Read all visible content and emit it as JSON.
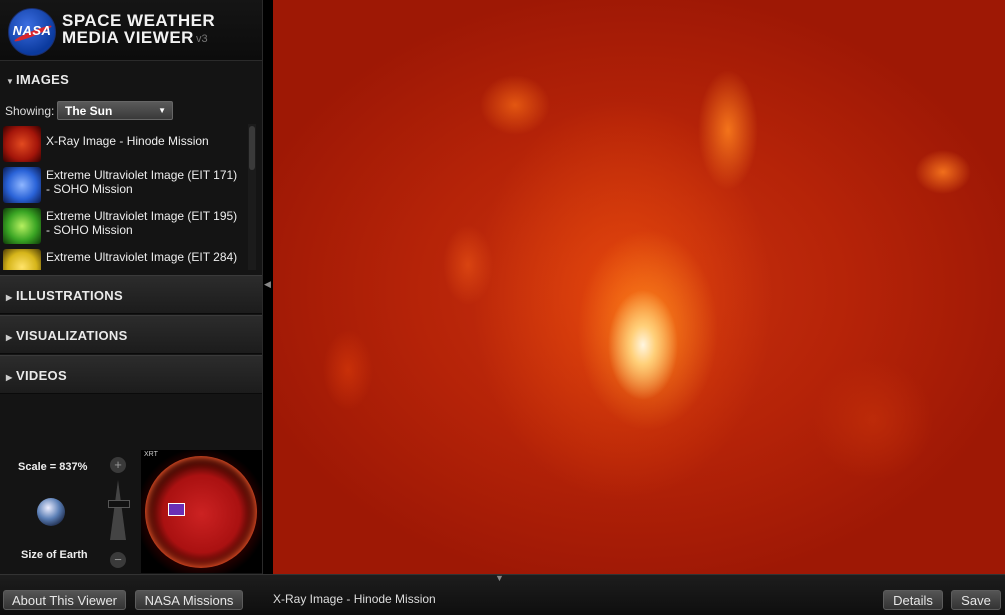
{
  "header": {
    "logo_text": "NASA",
    "title_line1": "SPACE WEATHER",
    "title_line2": "MEDIA VIEWER",
    "version": "v3"
  },
  "sections": {
    "images": "IMAGES",
    "illustrations": "ILLUSTRATIONS",
    "visualizations": "VISUALIZATIONS",
    "videos": "VIDEOS"
  },
  "showing": {
    "label": "Showing:",
    "selected": "The Sun"
  },
  "image_list": [
    {
      "label": "X-Ray Image - Hinode Mission",
      "thumb_color": "#c0200e"
    },
    {
      "label": "Extreme Ultraviolet Image (EIT 171) - SOHO Mission",
      "thumb_color": "#2a63d8"
    },
    {
      "label": "Extreme Ultraviolet Image (EIT 195) - SOHO Mission",
      "thumb_color": "#3aa524"
    },
    {
      "label": "Extreme Ultraviolet Image (EIT 284) -",
      "thumb_color": "#d6b51a"
    }
  ],
  "scale": {
    "label": "Scale = 837%",
    "earth_label": "Size of Earth",
    "zoom_in": "+",
    "zoom_out": "−",
    "minimap_tag": "XRT"
  },
  "viewer": {
    "caption": "X-Ray Image - Hinode Mission"
  },
  "buttons": {
    "about": "About This Viewer",
    "missions": "NASA Missions",
    "details": "Details",
    "save": "Save"
  },
  "colors": {
    "accent_red": "#d8262e",
    "sun_red": "#b52308",
    "panel_bg": "#141414"
  }
}
